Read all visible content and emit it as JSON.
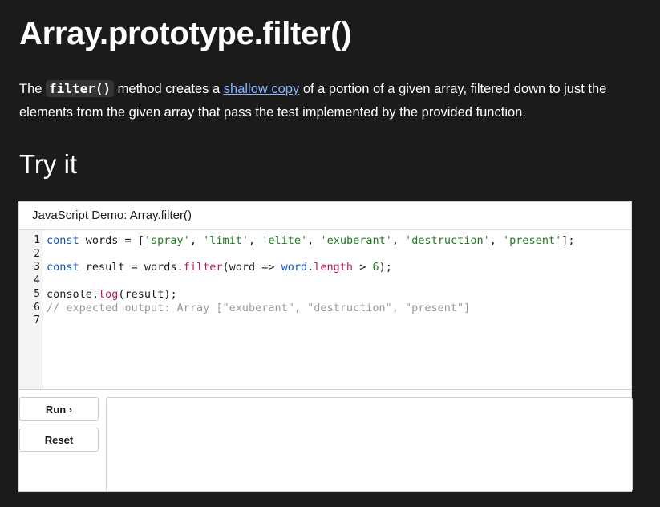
{
  "page": {
    "title": "Array.prototype.filter()",
    "description": {
      "before": "The ",
      "code": "filter()",
      "middle": " method creates a ",
      "link": "shallow copy",
      "after": " of a portion of a given array, filtered down to just the elements from the given array that pass the test implemented by the provided function."
    },
    "section_heading": "Try it"
  },
  "demo": {
    "header": "JavaScript Demo: Array.filter()",
    "line_numbers": [
      "1",
      "2",
      "3",
      "4",
      "5",
      "6",
      "7"
    ],
    "code": {
      "l1": {
        "kw": "const",
        "a": " words = [",
        "s1": "'spray'",
        "c1": ", ",
        "s2": "'limit'",
        "c2": ", ",
        "s3": "'elite'",
        "c3": ", ",
        "s4": "'exuberant'",
        "c4": ", ",
        "s5": "'destruction'",
        "c5": ", ",
        "s6": "'present'",
        "end": "];"
      },
      "l3": {
        "kw": "const",
        "a": " result = words.",
        "fn": "filter",
        "b": "(word => ",
        "obj": "word",
        "dot": ".",
        "prop": "length",
        "c": " > ",
        "num": "6",
        "end": ");"
      },
      "l5": {
        "a": "console.",
        "fn": "log",
        "end": "(result);"
      },
      "l6": {
        "comment": "// expected output: Array [\"exuberant\", \"destruction\", \"present\"]"
      }
    },
    "buttons": {
      "run": "Run ›",
      "reset": "Reset"
    },
    "output": ""
  }
}
